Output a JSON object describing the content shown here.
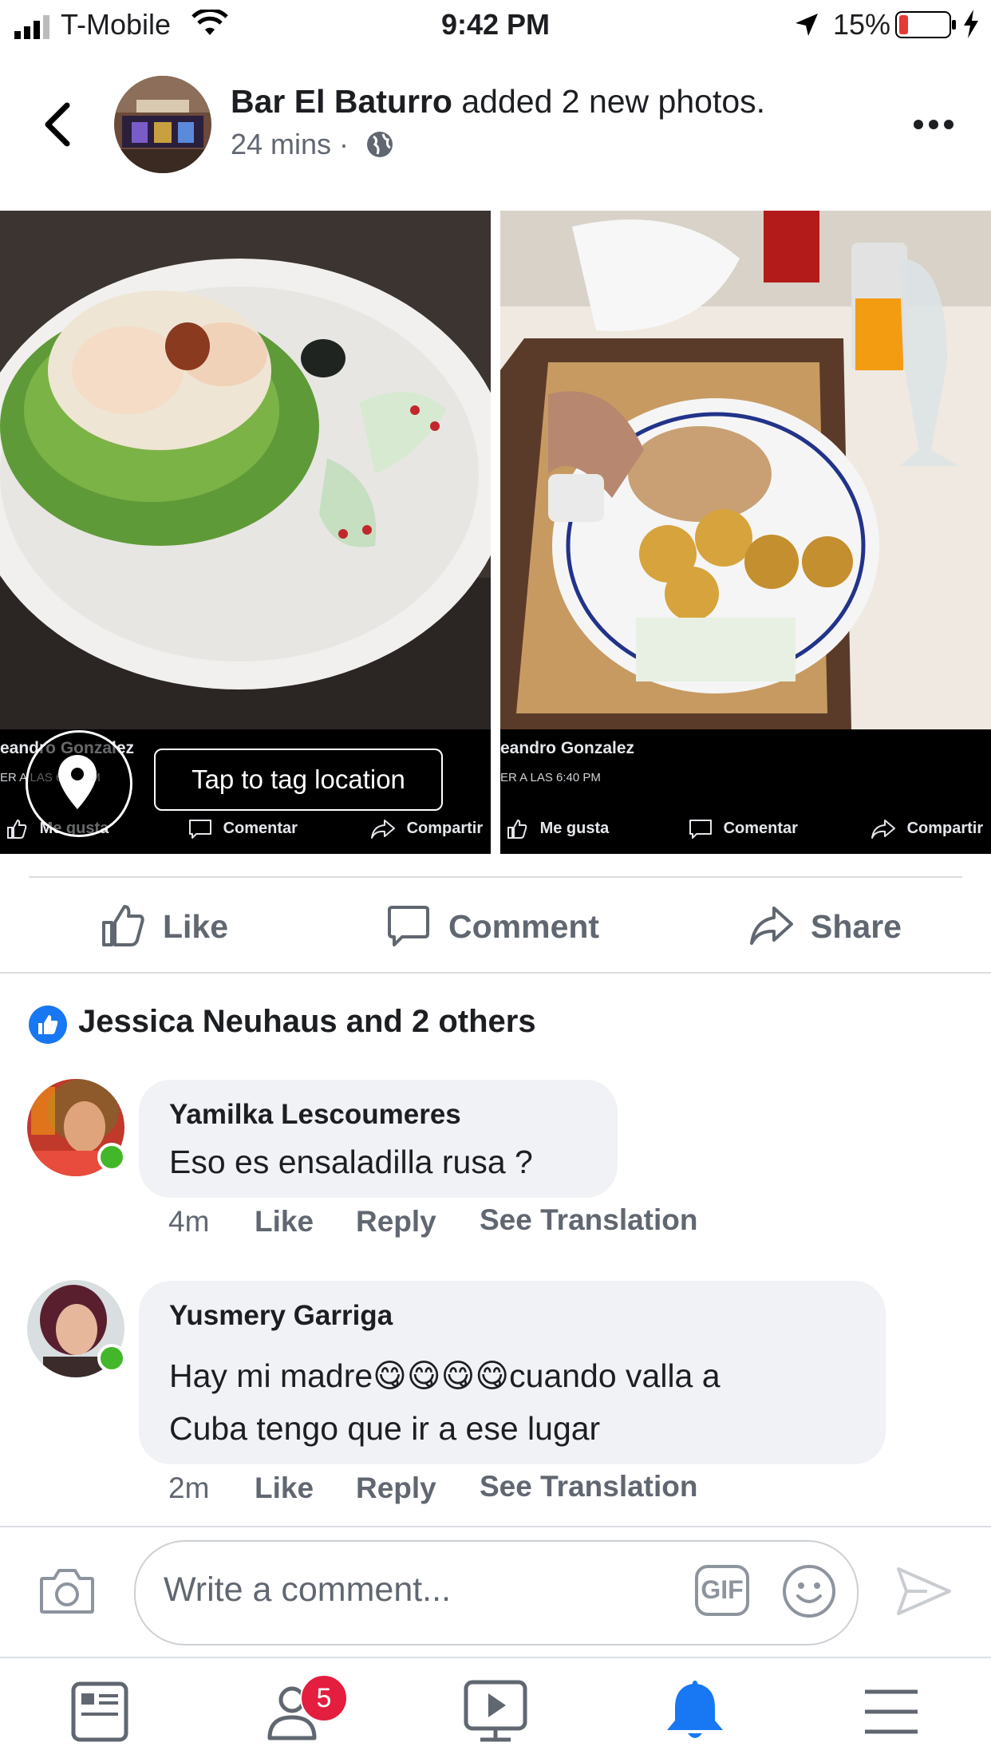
{
  "status_bar": {
    "carrier": "T-Mobile",
    "time": "9:42 PM",
    "battery": "15%"
  },
  "post": {
    "page_name": "Bar El Baturro",
    "action_text": "added 2 new photos.",
    "time": "24 mins ·",
    "photos": [
      {
        "overlay_name": "eandro Gonzalez",
        "overlay_date": "ER A LAS 6:40 PM",
        "overlay_like": "Me gusta",
        "overlay_comment": "Comentar",
        "overlay_share": "Compartir"
      },
      {
        "overlay_name": "eandro Gonzalez",
        "overlay_date": "ER A LAS 6:40 PM",
        "overlay_like": "Me gusta",
        "overlay_comment": "Comentar",
        "overlay_share": "Compartir"
      }
    ],
    "tag_location_label": "Tap to tag location"
  },
  "actions": {
    "like": "Like",
    "comment": "Comment",
    "share": "Share"
  },
  "reactions": {
    "summary": "Jessica Neuhaus and 2 others"
  },
  "comments": [
    {
      "author": "Yamilka Lescoumeres",
      "text": "Eso es ensaladilla rusa ?",
      "time": "4m",
      "like": "Like",
      "reply": "Reply",
      "translate": "See Translation"
    },
    {
      "author": "Yusmery Garriga",
      "text_line1": "Hay mi madre😋😋😋😋cuando valla a",
      "text_line2": "Cuba tengo que ir a ese lugar",
      "time": "2m",
      "like": "Like",
      "reply": "Reply",
      "translate": "See Translation"
    }
  ],
  "composer": {
    "placeholder": "Write a comment...",
    "gif_label": "GIF"
  },
  "tab_bar": {
    "friends_badge": "5",
    "active": "notifications",
    "accent": "#1877f2"
  },
  "icons": [
    "back-icon",
    "more-icon",
    "globe-icon",
    "location-pin-icon",
    "like-icon",
    "comment-icon",
    "share-icon",
    "camera-icon",
    "gif-icon",
    "emoji-icon",
    "send-icon",
    "news-feed-icon",
    "friends-icon",
    "watch-icon",
    "bell-icon",
    "menu-icon"
  ]
}
